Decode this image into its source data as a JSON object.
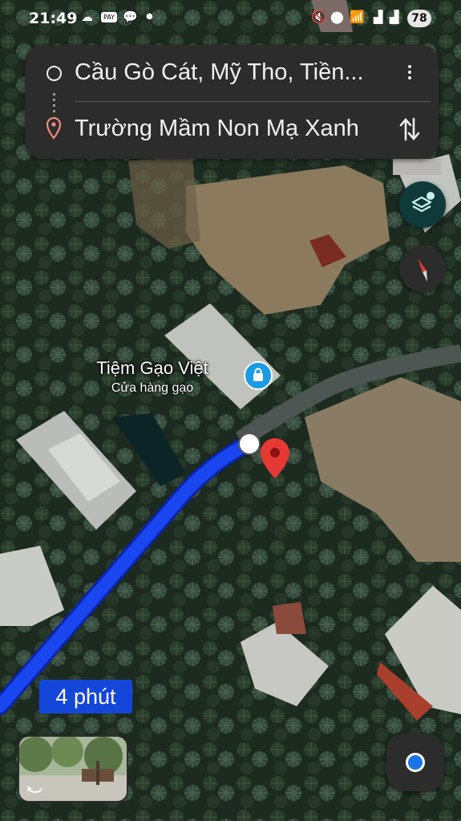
{
  "status_bar": {
    "time": "21:49",
    "battery": "78",
    "left_icons": [
      "cloud-icon",
      "pay-icon",
      "chat-icon",
      "dot-icon"
    ],
    "right_icons": [
      "mute-icon",
      "location-icon",
      "wifi-icon",
      "signal-icon"
    ]
  },
  "directions": {
    "origin": "Cầu Gò Cát, Mỹ Tho, Tiền...",
    "destination": "Trường Mầm Non Mạ Xanh"
  },
  "map": {
    "view": "satellite",
    "place_name": "Tiệm Gạo Việt",
    "place_category": "Cửa hàng gạo",
    "route_time": "4 phút",
    "colors": {
      "route": "#1a46f0",
      "destination_pin": "#e53935",
      "place_icon": "#1a9be6"
    }
  }
}
